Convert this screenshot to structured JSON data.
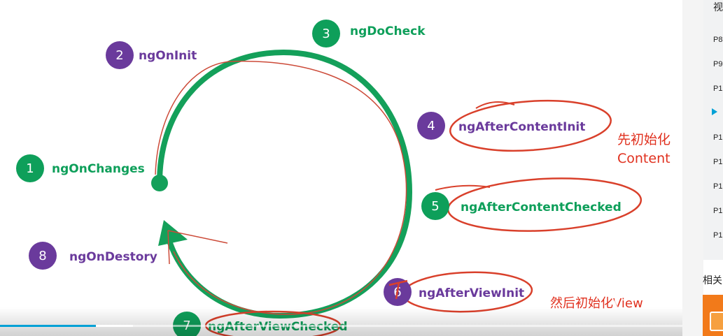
{
  "lifecycle": {
    "nodes": [
      {
        "num": "1",
        "label": "ngOnChanges",
        "color": "#0e9f5a"
      },
      {
        "num": "2",
        "label": "ngOnInit",
        "color": "#6a3a9c"
      },
      {
        "num": "3",
        "label": "ngDoCheck",
        "color": "#0e9f5a"
      },
      {
        "num": "4",
        "label": "ngAfterContentInit",
        "color": "#6a3a9c"
      },
      {
        "num": "5",
        "label": "ngAfterContentChecked",
        "color": "#0e9f5a"
      },
      {
        "num": "6",
        "label": "ngAfterViewInit",
        "color": "#6a3a9c"
      },
      {
        "num": "7",
        "label": "ngAfterViewChecked",
        "color": "#0e9f5a"
      },
      {
        "num": "8",
        "label": "ngOnDestory",
        "color": "#6a3a9c"
      }
    ],
    "cycle_color": "#14a05a",
    "annotation_color": "#d9402b"
  },
  "annotations": {
    "content_line1": "先初始化",
    "content_line2": "Content",
    "view_note": "然后初始化View"
  },
  "player": {
    "progress_fraction": 0.14
  },
  "playlist": {
    "items": [
      "视",
      "P8",
      "P9",
      "P1",
      "",
      "P1",
      "P1",
      "P1",
      "P1",
      "P1"
    ],
    "active_index": 4
  },
  "related": {
    "label": "相关"
  }
}
